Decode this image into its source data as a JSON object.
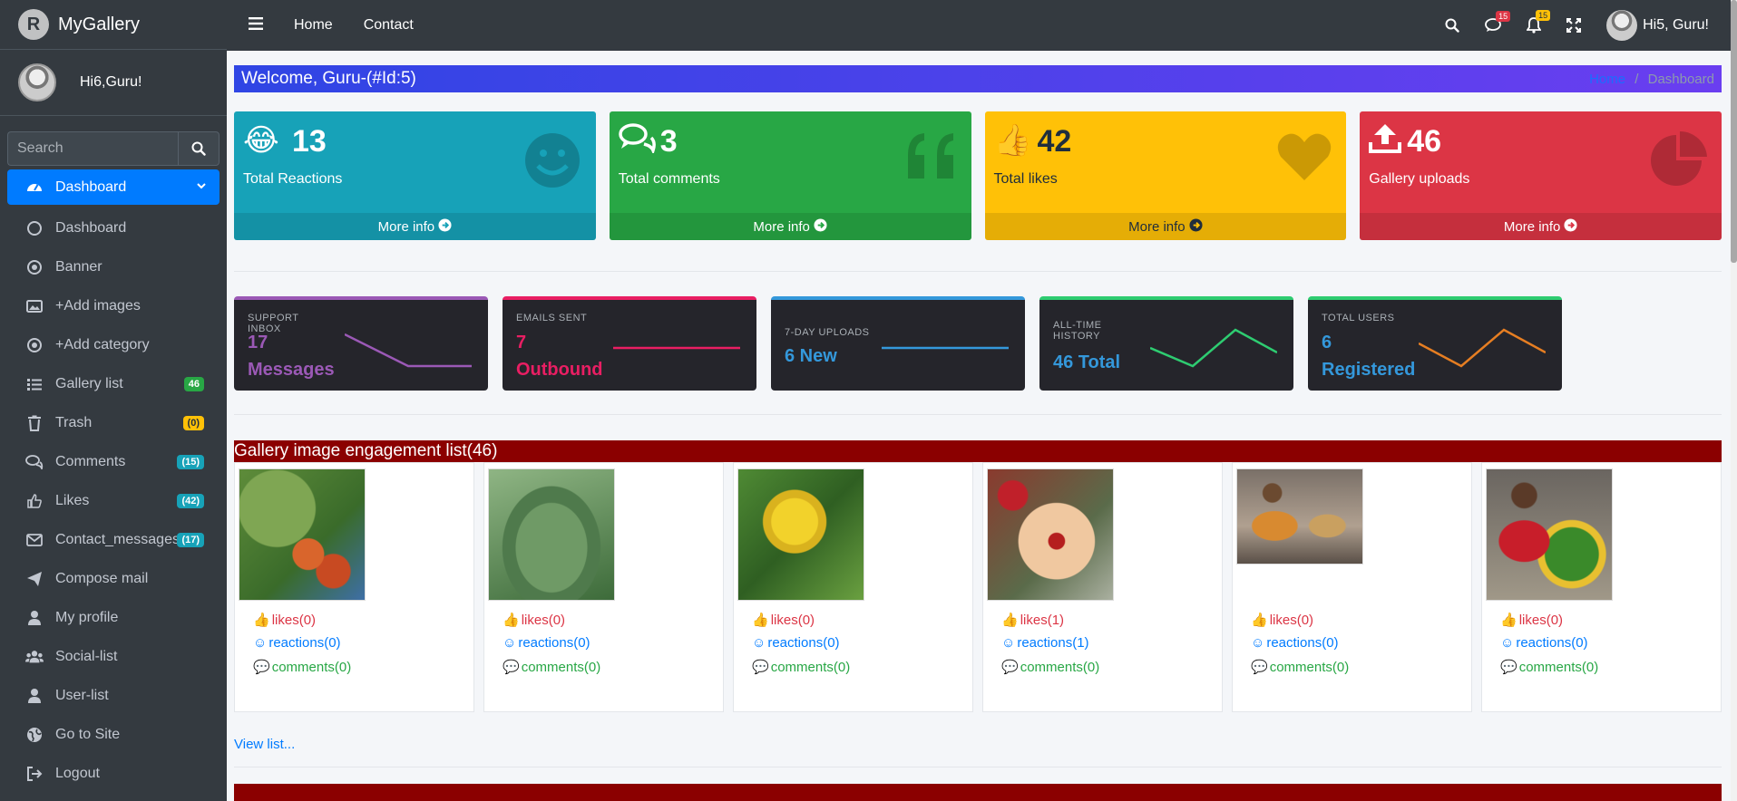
{
  "brand": {
    "name": "MyGallery",
    "logo_letter": "R"
  },
  "user_panel": {
    "name": "Hi6,Guru!"
  },
  "search": {
    "placeholder": "Search"
  },
  "sidebar": {
    "items": [
      {
        "label": "Dashboard",
        "icon": "dashboard-gauge-icon",
        "active": true
      },
      {
        "label": "Dashboard",
        "icon": "circle-icon"
      },
      {
        "label": "Banner",
        "icon": "dot-circle-icon"
      },
      {
        "label": "+Add images",
        "icon": "image-icon"
      },
      {
        "label": "+Add category",
        "icon": "dot-circle-icon"
      },
      {
        "label": "Gallery list",
        "icon": "list-icon",
        "badge": "46",
        "badge_color": "#28a745"
      },
      {
        "label": "Trash",
        "icon": "trash-icon",
        "badge": "(0)",
        "badge_color": "#ffc107"
      },
      {
        "label": "Comments",
        "icon": "comments-icon",
        "badge": "(15)",
        "badge_color": "#17a2b8"
      },
      {
        "label": "Likes",
        "icon": "thumbs-up-icon",
        "badge": "(42)",
        "badge_color": "#17a2b8"
      },
      {
        "label": "Contact_messages",
        "icon": "envelope-icon",
        "badge": "(17)",
        "badge_color": "#17a2b8"
      },
      {
        "label": "Compose mail",
        "icon": "paper-plane-icon"
      },
      {
        "label": "My profile",
        "icon": "user-icon"
      },
      {
        "label": "Social-list",
        "icon": "users-icon"
      },
      {
        "label": "User-list",
        "icon": "user-icon"
      },
      {
        "label": "Go to Site",
        "icon": "globe-icon"
      },
      {
        "label": "Logout",
        "icon": "sign-out-icon"
      }
    ]
  },
  "topbar": {
    "home": "Home",
    "contact": "Contact",
    "messages_count": "15",
    "notifications_count": "15",
    "user_label": "Hi5, Guru!"
  },
  "header": {
    "welcome": "Welcome, Guru-(#Id:5)",
    "breadcrumb_home": "Home",
    "breadcrumb_sep": "/",
    "breadcrumb_current": "Dashboard"
  },
  "stat_boxes": [
    {
      "value": "13",
      "label": "Total Reactions",
      "more": "More info",
      "color": "#17a2b8"
    },
    {
      "value": "3",
      "label": "Total comments",
      "more": "More info",
      "color": "#28a745"
    },
    {
      "value": "42",
      "label": "Total likes",
      "more": "More info",
      "color": "#ffc107"
    },
    {
      "value": "46",
      "label": "Gallery uploads",
      "more": "More info",
      "color": "#dc3545"
    }
  ],
  "mini_cards": [
    {
      "label": "SUPPORT INBOX",
      "value": "17",
      "unit": "Messages",
      "color": "#9b59b6"
    },
    {
      "label": "EMAILS SENT",
      "value": "7",
      "unit": "Outbound",
      "color": "#e91e63"
    },
    {
      "label": "7-DAY UPLOADS",
      "value": "6 New",
      "unit": "",
      "color": "#3498db"
    },
    {
      "label": "ALL-TIME HISTORY",
      "value": "46 Total",
      "unit": "",
      "color": "#2ecc71"
    },
    {
      "label": "TOTAL USERS",
      "value": "6",
      "unit": "Registered",
      "color": "#e67e22"
    }
  ],
  "gallery_section": {
    "title": "Gallery image engagement list(46)",
    "view_list": "View list...",
    "items": [
      {
        "likes": "likes(0)",
        "reactions": "reactions(0)",
        "comments": "comments(0)"
      },
      {
        "likes": "likes(0)",
        "reactions": "reactions(0)",
        "comments": "comments(0)"
      },
      {
        "likes": "likes(0)",
        "reactions": "reactions(0)",
        "comments": "comments(0)"
      },
      {
        "likes": "likes(1)",
        "reactions": "reactions(1)",
        "comments": "comments(0)"
      },
      {
        "likes": "likes(0)",
        "reactions": "reactions(0)",
        "comments": "comments(0)"
      },
      {
        "likes": "likes(0)",
        "reactions": "reactions(0)",
        "comments": "comments(0)"
      }
    ]
  }
}
